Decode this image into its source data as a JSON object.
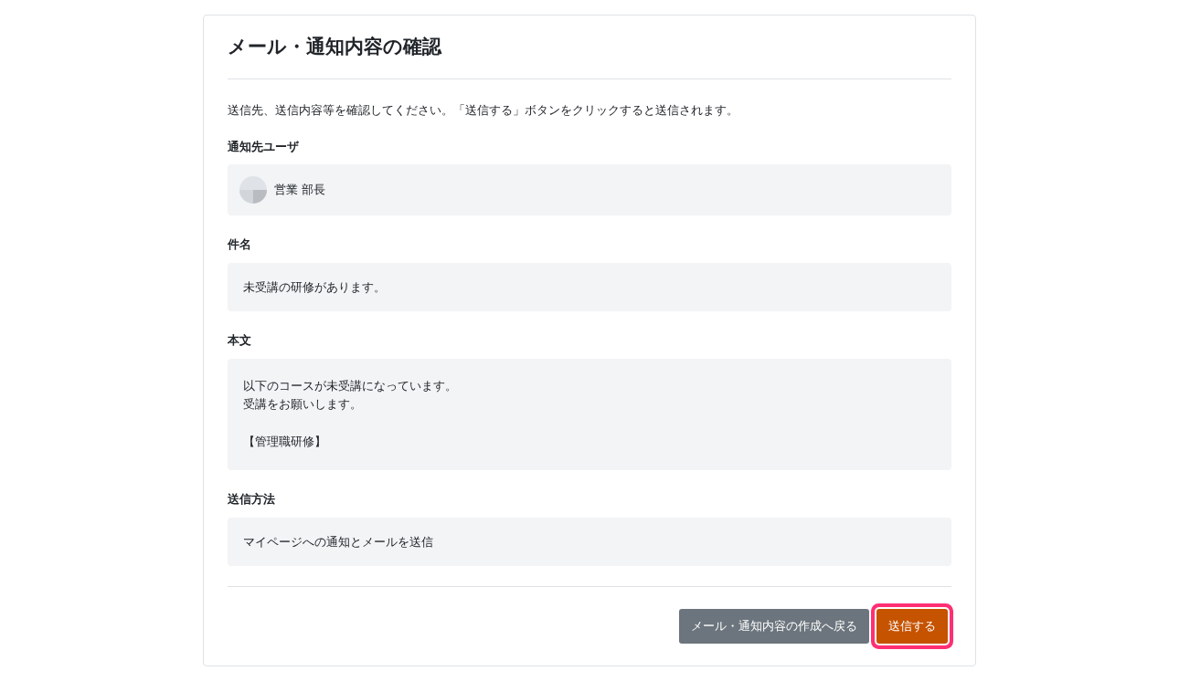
{
  "title": "メール・通知内容の確認",
  "intro": "送信先、送信内容等を確認してください。「送信する」ボタンをクリックすると送信されます。",
  "fields": [
    {
      "kind": "user",
      "label": "通知先ユーザ",
      "value": "営業 部長"
    },
    {
      "kind": "text",
      "label": "件名",
      "value": "未受講の研修があります。"
    },
    {
      "kind": "multiline",
      "label": "本文",
      "paragraphs": [
        [
          "以下のコースが未受講になっています。",
          "受講をお願いします。"
        ],
        [
          "【管理職研修】"
        ]
      ]
    },
    {
      "kind": "text",
      "label": "送信方法",
      "value": "マイページへの通知とメールを送信"
    }
  ],
  "buttons": [
    {
      "kind": "secondary",
      "label": "メール・通知内容の作成へ戻る",
      "highlighted": false
    },
    {
      "kind": "primary",
      "label": "送信する",
      "highlighted": true
    }
  ]
}
